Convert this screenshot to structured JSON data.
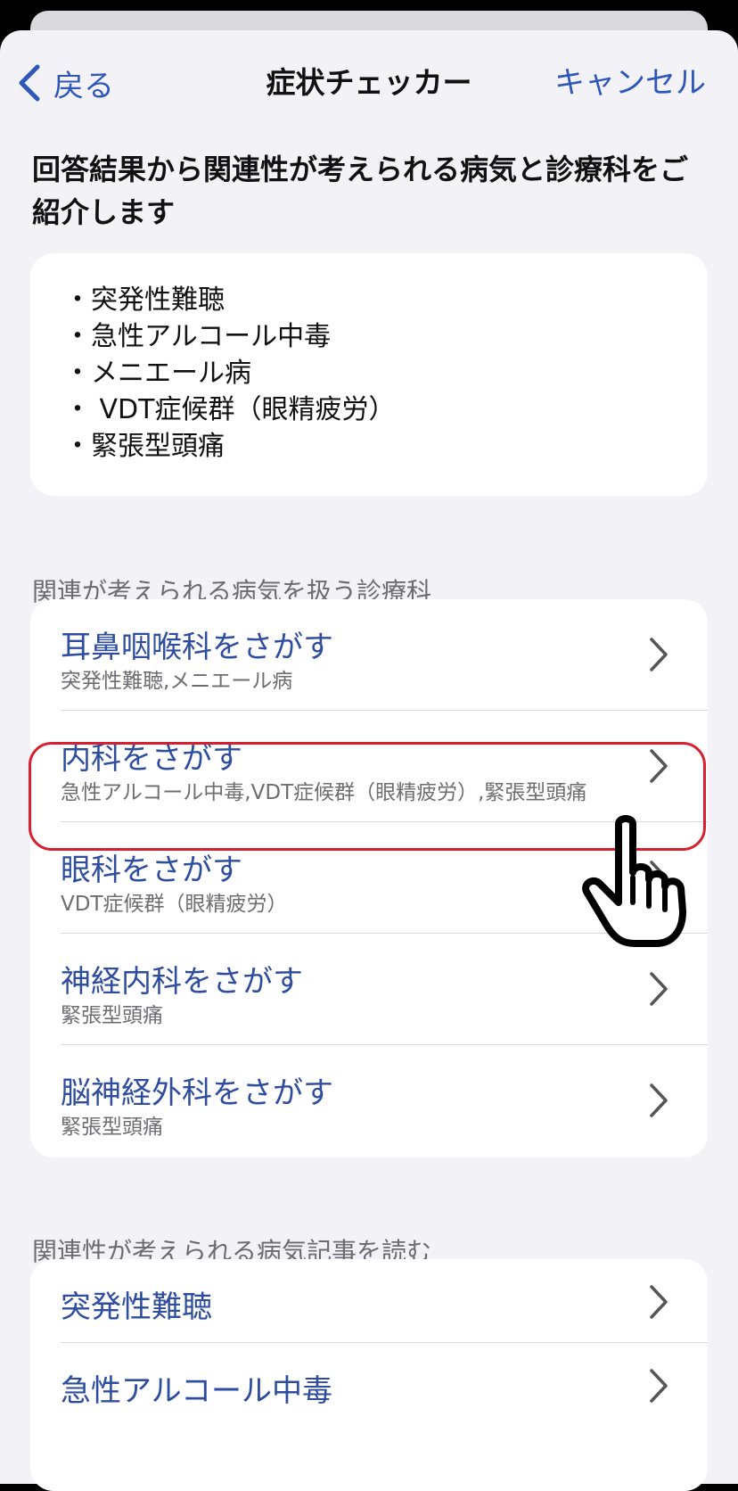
{
  "nav": {
    "back_label": "戻る",
    "title": "症状チェッカー",
    "cancel_label": "キャンセル"
  },
  "headline": "回答結果から関連性が考えられる病気と診療科をご紹介します",
  "diseases": [
    "・突発性難聴",
    "・急性アルコール中毒",
    "・メニエール病",
    "・ VDT症候群（眼精疲労）",
    "・緊張型頭痛"
  ],
  "departments_section_label": "関連が考えられる病気を扱う診療科",
  "departments": [
    {
      "title": "耳鼻咽喉科をさがす",
      "sub": "突発性難聴,メニエール病"
    },
    {
      "title": "内科をさがす",
      "sub": "急性アルコール中毒,VDT症候群（眼精疲労）,緊張型頭痛"
    },
    {
      "title": "眼科をさがす",
      "sub": "VDT症候群（眼精疲労）"
    },
    {
      "title": "神経内科をさがす",
      "sub": "緊張型頭痛"
    },
    {
      "title": "脳神経外科をさがす",
      "sub": "緊張型頭痛"
    }
  ],
  "articles_section_label": "関連性が考えられる病気記事を読む",
  "articles": [
    {
      "title": "突発性難聴"
    },
    {
      "title": "急性アルコール中毒"
    }
  ],
  "colors": {
    "accent": "#2e57b9",
    "highlight": "#d6202f",
    "background": "#f2f2f7"
  },
  "icons": {
    "back": "chevron-left-icon",
    "row": "chevron-right-icon",
    "pointer": "hand-pointer-icon"
  }
}
